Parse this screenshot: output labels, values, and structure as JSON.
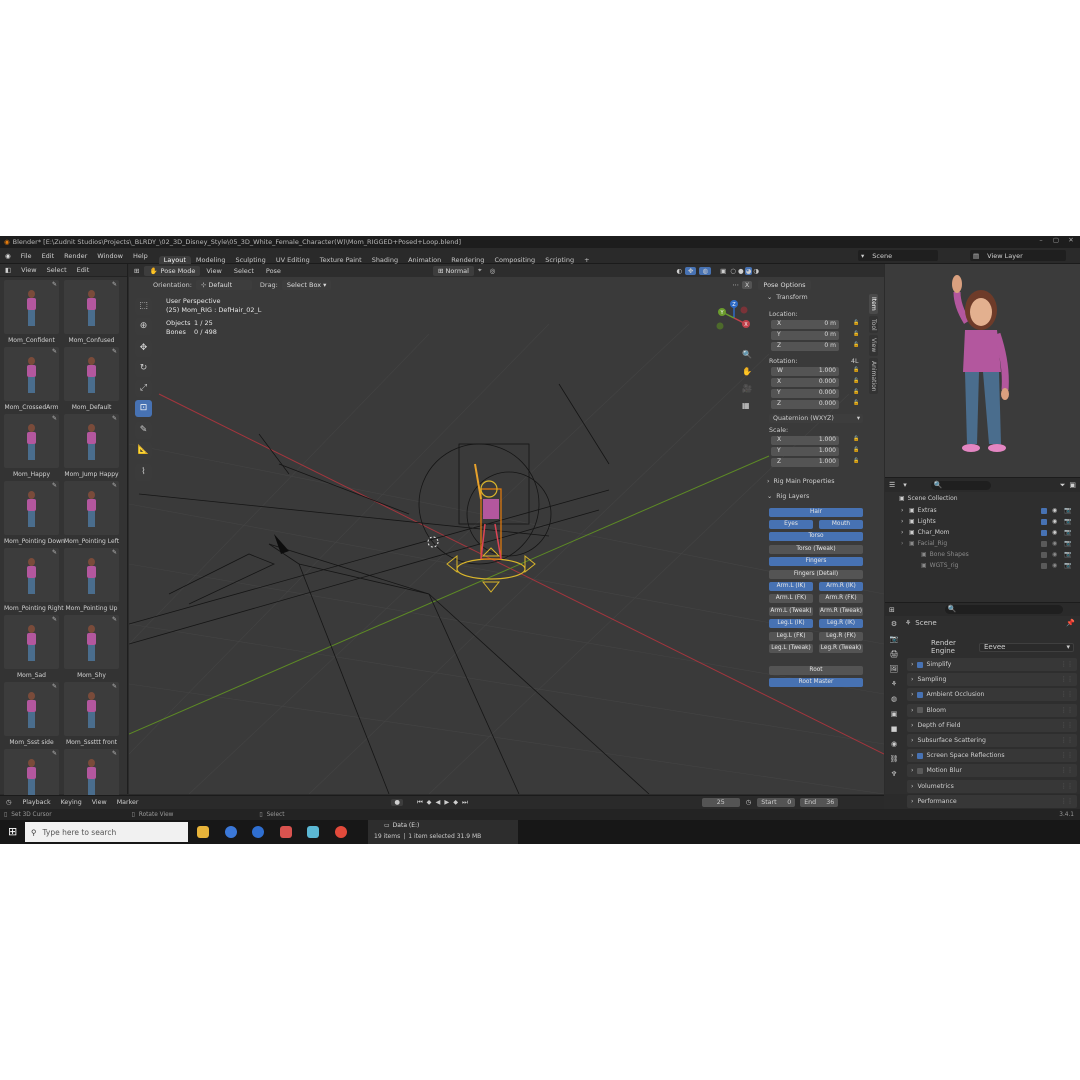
{
  "window": {
    "title": "Blender* [E:\\Zudnit Studios\\Projects\\_BLRDY_\\02_3D_Disney_Style\\05_3D_White_Female_Character(W)\\Mom_RIGGED+Posed+Loop.blend]"
  },
  "topmenu": {
    "items": [
      "File",
      "Edit",
      "Render",
      "Window",
      "Help"
    ],
    "workspaces": [
      "Layout",
      "Modeling",
      "Sculpting",
      "UV Editing",
      "Texture Paint",
      "Shading",
      "Animation",
      "Rendering",
      "Compositing",
      "Scripting"
    ],
    "active_workspace": "Layout",
    "scene": "Scene",
    "view_layer": "View Layer"
  },
  "asset_browser": {
    "menu": [
      "View",
      "Select",
      "Edit"
    ],
    "poses": [
      "Mom_Confident",
      "Mom_Confused",
      "Mom_CrossedArm",
      "Mom_Default",
      "Mom_Happy",
      "Mom_Jump Happy",
      "Mom_Pointing Down",
      "Mom_Pointing Left",
      "Mom_Pointing Right",
      "Mom_Pointing Up",
      "Mom_Sad",
      "Mom_Shy",
      "Mom_Ssst side",
      "Mom_Sssttt front",
      "",
      ""
    ]
  },
  "viewport": {
    "mode": "Pose Mode",
    "menu": [
      "View",
      "Select",
      "Pose"
    ],
    "orientation_label": "Orientation:",
    "orientation": "Default",
    "drag_label": "Drag:",
    "drag": "Select Box",
    "pivot": "Normal",
    "pose_options": "Pose Options",
    "overlay_title": "User Perspective",
    "overlay_object": "(25) Mom_RIG : DefHair_02_L",
    "objects_label": "Objects",
    "objects_value": "1 / 25",
    "bones_label": "Bones",
    "bones_value": "0 / 498",
    "gizmo_axes": [
      "Z",
      "Y",
      "X"
    ]
  },
  "npanel": {
    "tabs": [
      "Item",
      "Tool",
      "View",
      "Animation"
    ],
    "transform_title": "Transform",
    "location_label": "Location:",
    "location": [
      {
        "k": "X",
        "v": "0 m"
      },
      {
        "k": "Y",
        "v": "0 m"
      },
      {
        "k": "Z",
        "v": "0 m"
      }
    ],
    "rotation_label": "Rotation:",
    "rotation_mode_tag": "4L",
    "rotation": [
      {
        "k": "W",
        "v": "1.000"
      },
      {
        "k": "X",
        "v": "0.000"
      },
      {
        "k": "Y",
        "v": "0.000"
      },
      {
        "k": "Z",
        "v": "0.000"
      }
    ],
    "rotation_mode": "Quaternion (WXYZ)",
    "scale_label": "Scale:",
    "scale": [
      {
        "k": "X",
        "v": "1.000"
      },
      {
        "k": "Y",
        "v": "1.000"
      },
      {
        "k": "Z",
        "v": "1.000"
      }
    ],
    "rig_main": "Rig Main Properties",
    "rig_layers_title": "Rig Layers",
    "rig_layers": {
      "hair": "Hair",
      "eyes": "Eyes",
      "mouth": "Mouth",
      "torso": "Torso",
      "torso_tweak": "Torso (Tweak)",
      "fingers": "Fingers",
      "fingers_detail": "Fingers (Detail)",
      "arm_l_ik": "Arm.L (IK)",
      "arm_r_ik": "Arm.R (IK)",
      "arm_l_fk": "Arm.L (FK)",
      "arm_r_fk": "Arm.R (FK)",
      "arm_l_tweak": "Arm.L (Tweak)",
      "arm_r_tweak": "Arm.R (Tweak)",
      "leg_l_ik": "Leg.L (IK)",
      "leg_r_ik": "Leg.R (IK)",
      "leg_l_fk": "Leg.L (FK)",
      "leg_r_fk": "Leg.R (FK)",
      "leg_l_tweak": "Leg.L (Tweak)",
      "leg_r_tweak": "Leg.R (Tweak)",
      "root": "Root",
      "root_master": "Root Master"
    }
  },
  "outliner": {
    "title": "Scene Collection",
    "items": [
      "Extras",
      "Lights",
      "Char_Mom",
      "Facial_Rig",
      "Bone Shapes",
      "WGTS_rig"
    ]
  },
  "properties": {
    "title": "Scene",
    "render_engine_label": "Render Engine",
    "render_engine": "Eevee",
    "sections": [
      {
        "label": "Simplify",
        "checkbox": "on"
      },
      {
        "label": "Sampling",
        "checkbox": "none"
      },
      {
        "label": "Ambient Occlusion",
        "checkbox": "on"
      },
      {
        "label": "Bloom",
        "checkbox": "off"
      },
      {
        "label": "Depth of Field",
        "checkbox": "none"
      },
      {
        "label": "Subsurface Scattering",
        "checkbox": "none"
      },
      {
        "label": "Screen Space Reflections",
        "checkbox": "on"
      },
      {
        "label": "Motion Blur",
        "checkbox": "off"
      },
      {
        "label": "Volumetrics",
        "checkbox": "none"
      },
      {
        "label": "Performance",
        "checkbox": "none"
      }
    ]
  },
  "timeline": {
    "menu": [
      "Playback",
      "Keying",
      "View",
      "Marker"
    ],
    "current_frame": "25",
    "start_label": "Start",
    "start": "0",
    "end_label": "End",
    "end": "36"
  },
  "statusbar": {
    "hint1": "Set 3D Cursor",
    "hint2": "Rotate View",
    "hint3": "Select",
    "version": "3.4.1"
  },
  "taskbar": {
    "search_placeholder": "Type here to search",
    "explorer_title": "Data (E:)",
    "explorer_items": "19 items",
    "explorer_selected": "1 item selected  31.9 MB"
  },
  "colors": {
    "accent": "#4772b3",
    "x_axis": "#c2414b",
    "y_axis": "#6b9c2d",
    "z_axis": "#2e6bc5",
    "outfit": "#b3579e"
  }
}
